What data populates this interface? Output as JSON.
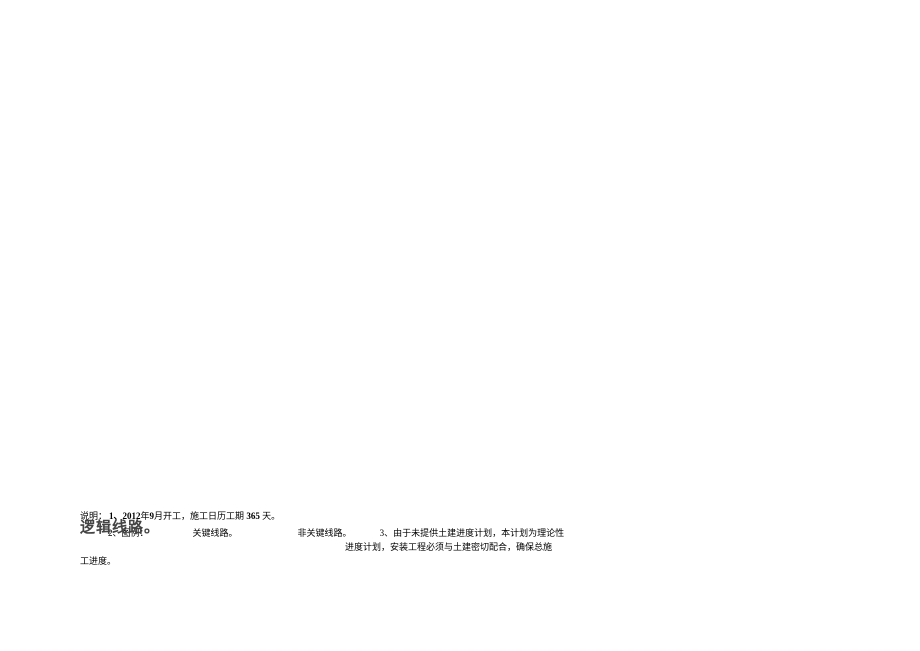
{
  "overlay": {
    "title": "逻辑线路。"
  },
  "notes": {
    "label": "说明：",
    "item1_num": "1、",
    "item1_year": "2012",
    "item1_mid": "年",
    "item1_month": "9",
    "item1_rest": "月开工，施工日历工期",
    "item1_days": "365",
    "item1_days_unit": "天。",
    "item2_num": "2、",
    "item2_label": "图例：",
    "item2_critical": "关键线路。",
    "item2_noncritical": "非关键线路。",
    "item3_num": "3、",
    "item3_text_a": "由于未提供土建进度计划，本计划为理论性",
    "item3_text_b": "进度计划，安装工程必须与土建密切配合，确保总施",
    "item3_text_c": "工进度。"
  }
}
